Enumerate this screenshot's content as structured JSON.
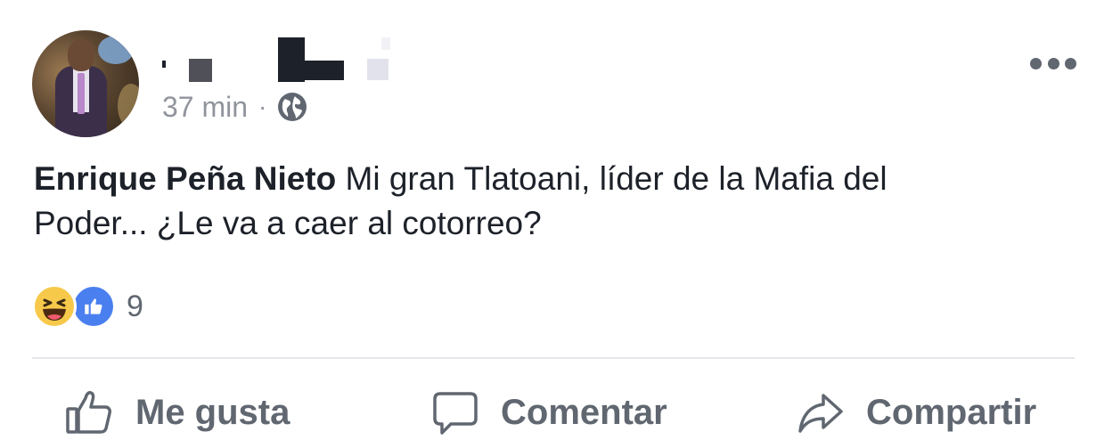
{
  "post": {
    "time": "37 min",
    "separator": "·",
    "audience_icon": "globe-icon",
    "more_icon": "more-options-icon",
    "author_tag": "Enrique Peña Nieto",
    "text_line1": " Mi gran Tlatoani, líder de la Mafia del",
    "text_line2": "Poder...  ¿Le va a caer al cotorreo?"
  },
  "reactions": {
    "icons": [
      "haha-reaction-icon",
      "like-reaction-icon"
    ],
    "count": "9"
  },
  "actions": {
    "like_label": "Me gusta",
    "comment_label": "Comentar",
    "share_label": "Compartir"
  },
  "colors": {
    "text": "#1d2129",
    "secondary": "#90949c",
    "action": "#606770",
    "like_blue": "#4a7ff0",
    "haha_yellow": "#f7c94b",
    "divider": "#e5e6e9"
  }
}
